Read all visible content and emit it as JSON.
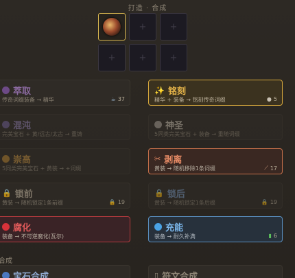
{
  "header": {
    "title": "打造 · 合成"
  },
  "slots": {
    "empty_glyph": "+"
  },
  "cards": {
    "extract": {
      "name": "萃取",
      "desc": "传奇词缀装备 → 精华",
      "cost": "37",
      "color": "#8b6aa0"
    },
    "chaos": {
      "name": "混沌",
      "desc": "完美宝石 + 黄/远古/太古 → 重铸"
    },
    "exalt": {
      "name": "崇高",
      "desc": "5同类完美宝石 + 黄装 → +词缀"
    },
    "lock": {
      "name": "锁前",
      "desc": "黄装 → 随机锁定1条前缀",
      "cost": "19"
    },
    "corrupt": {
      "name": "腐化",
      "desc": "装备 → 不可逆腐化(瓦尔)",
      "color": "#e05a5a"
    },
    "inscribe": {
      "name": "铭刻",
      "desc": "精华 + 装备 → 铭刻传奇词缀",
      "cost": "5",
      "color": "#e8b64a"
    },
    "divine": {
      "name": "神圣",
      "desc": "5同类完美宝石 + 装备 → 重随词缀"
    },
    "strip": {
      "name": "剥离",
      "desc": "黄装 → 随机移除1条词缀",
      "cost": "17",
      "color": "#e98c66"
    },
    "lock2": {
      "name": "锁后",
      "desc": "黄装 → 随机锁定1条后缀",
      "cost": "19"
    },
    "charge": {
      "name": "充能",
      "desc": "装备 → 耐久补满",
      "cost": "6",
      "color": "#7ab6ea"
    }
  },
  "synthesis": {
    "label": "合成",
    "gem": {
      "name": "宝石合成"
    },
    "rune": {
      "name": "符文合成"
    }
  }
}
